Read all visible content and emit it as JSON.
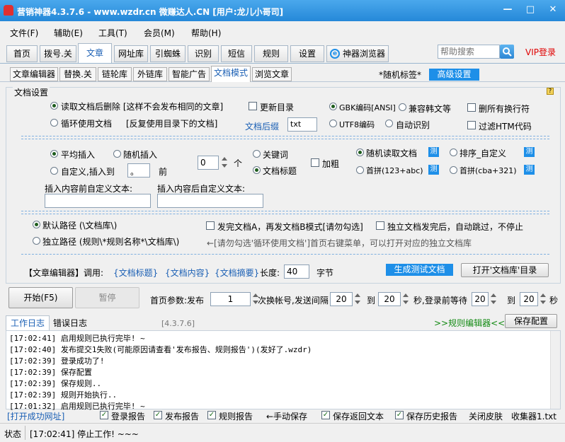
{
  "window": {
    "title": "营销神器4.3.7.6 - www.wzdr.cn 微赚达人.CN [用户:龙儿小哥司]"
  },
  "menu": [
    "文件(F)",
    "辅助(E)",
    "工具(T)",
    "会员(M)",
    "帮助(H)"
  ],
  "main_tabs": [
    "首页",
    "拨号.关",
    "文章",
    "网址库",
    "引蜘蛛",
    "识别",
    "短信",
    "规则",
    "设置",
    "神器浏览器"
  ],
  "search": {
    "placeholder": "帮助搜索"
  },
  "vip_login": "VIP登录",
  "sub_tabs": [
    "文章编辑器",
    "替换.关",
    "链轮库",
    "外链库",
    "智能广告",
    "文档模式",
    "浏览文章"
  ],
  "random_tag": "*随机标签*",
  "advanced_btn": "高级设置",
  "panel": {
    "title": "文档设置",
    "read_delete": "读取文档后删除 [这样不会发布相同的文章]",
    "loop_use": "循环使用文档",
    "loop_note": "[反复使用目录下的文档]",
    "update_dir": "更新目录",
    "doc_suffix_label": "文档后缀",
    "doc_suffix_value": "txt",
    "gbk": "GBK编码[ANSI]",
    "compat_kr": "兼容韩文等",
    "utf8": "UTF8编码",
    "auto_detect": "自动识别",
    "remove_newlines": "删所有换行符",
    "filter_html": "过滤HTM代码",
    "avg_insert": "平均插入",
    "rand_insert": "随机插入",
    "custom_insert": "自定义,插入到",
    "custom_insert_val": "。",
    "before": "前",
    "count_val": "0",
    "count_unit": "个",
    "keyword": "关键词",
    "doc_title": "文档标题",
    "bold": "加粗",
    "rand_read": "随机读取文档",
    "sort_custom": "排序_自定义",
    "pinyin_asc": "首拼(123+abc)",
    "pinyin_desc": "首拼(cba+321)",
    "ce": "测",
    "before_text_label": "插入内容前自定义文本:",
    "after_text_label": "插入内容后自定义文本:",
    "default_path": "默认路径 (\\文档库\\)",
    "indep_path": "独立路径 (规则\\*规则名称*\\文档库\\)",
    "send_ab": "发完文档A，再发文档B模式[请勿勾选]",
    "indep_skip": "独立文档发完后，自动跳过，不停止",
    "note": "←[请勿勾选'循环使用文档']首页右键菜单，可以打开对应的独立文档库",
    "editor_call": "【文章编辑器】调用:",
    "tag1": "{文档标题}",
    "tag2": "{文档内容}",
    "tag3": "{文档摘要}",
    "length_label": "长度:",
    "length_val": "40",
    "length_unit": "字节",
    "gen_test": "生成测试文档",
    "open_lib": "打开'文档库'目录"
  },
  "controls": {
    "start": "开始(F5)",
    "pause": "暂停",
    "home_params": "首页参数:发布",
    "publish_val": "1",
    "switch_interval": "次换帐号,发送间隔",
    "interval_from": "20",
    "to1": "到",
    "interval_to": "20",
    "wait_label": "秒,登录前等待",
    "wait_from": "20",
    "to2": "到",
    "wait_to": "20",
    "sec": "秒"
  },
  "log": {
    "tab_work": "工作日志",
    "tab_error": "错误日志",
    "version": "[4.3.7.6]",
    "rule_editor": ">>规则编辑器<<",
    "save_config": "保存配置",
    "lines": [
      "[17:02:41] 启用规则已执行完毕! ~",
      "[17:02:40] 发布提交1失败(可能原因请查看'发布报告、规则报告')(发好了.wzdr)",
      "[17:02:39] 登录成功了!",
      "[17:02:39] 保存配置",
      "[17:02:39] 保存规则..",
      "[17:02:39] 规则开始执行..",
      "[17:01:32] 启用规则已执行完毕! ~"
    ]
  },
  "bottom": {
    "open_site": "[打开成功网址]",
    "login_report": "登录报告",
    "publish_report": "发布报告",
    "rule_report": "规则报告",
    "manual_save": "←手动保存",
    "save_return": "保存返回文本",
    "save_history": "保存历史报告",
    "close_skin": "关闭皮肤",
    "collector": "收集器1.txt"
  },
  "status": {
    "label": "状态",
    "text": "[17:02:41] 停止工作! ~~~"
  }
}
